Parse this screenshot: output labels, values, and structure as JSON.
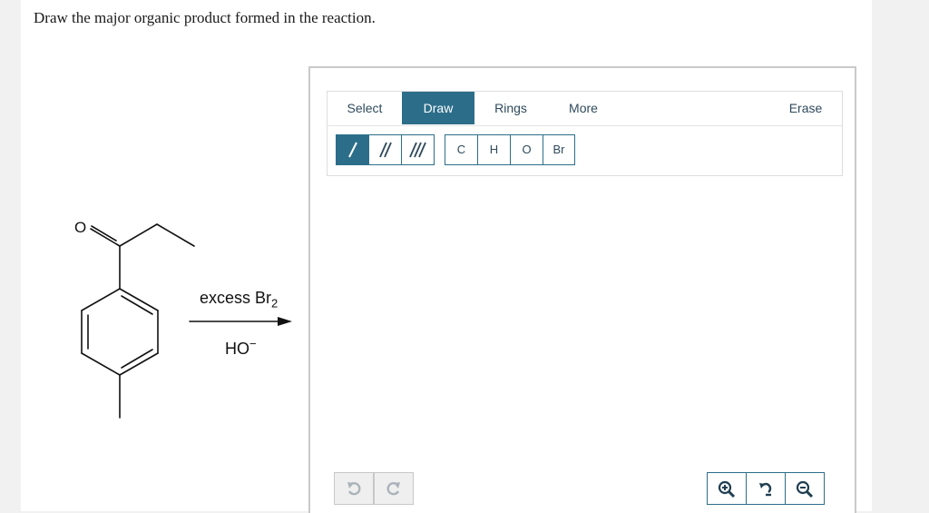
{
  "question": {
    "text": "Draw the major organic product formed in the reaction."
  },
  "scheme": {
    "oxygen_label": "O",
    "reagent": {
      "main": "excess Br",
      "subscript": "2"
    },
    "base": {
      "main": "HO",
      "superscript": "−"
    }
  },
  "editor": {
    "tabs": [
      {
        "label": "Select",
        "active": false
      },
      {
        "label": "Draw",
        "active": true
      },
      {
        "label": "Rings",
        "active": false
      },
      {
        "label": "More",
        "active": false
      },
      {
        "label": "Erase",
        "active": false
      }
    ],
    "bond_tools": [
      {
        "icon": "single-bond-icon",
        "active": true
      },
      {
        "icon": "double-bond-icon",
        "active": false
      },
      {
        "icon": "triple-bond-icon",
        "active": false
      }
    ],
    "atoms": [
      "C",
      "H",
      "O",
      "Br"
    ],
    "bottom_controls": {
      "undo_icon": "undo-icon",
      "redo_icon": "redo-icon",
      "zoom_in_icon": "zoom-in-icon",
      "zoom_reset_icon": "zoom-reset-icon",
      "zoom_out_icon": "zoom-out-icon"
    }
  },
  "colors": {
    "accent": "#2c6e8a",
    "page_background": "#f1f1f1",
    "panel_border": "#c9c9c9"
  }
}
